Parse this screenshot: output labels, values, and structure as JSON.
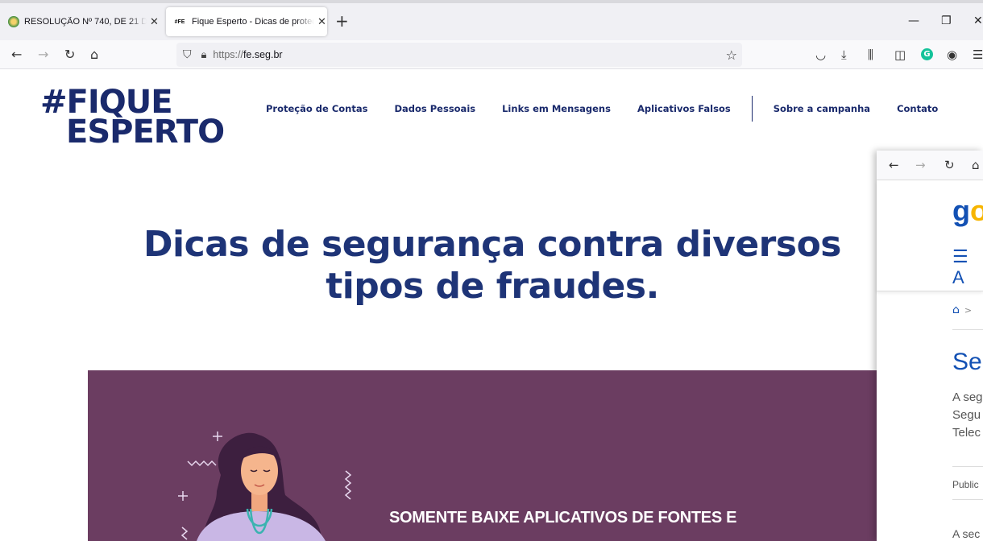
{
  "browser": {
    "tabs": [
      {
        "title": "RESOLUÇÃO Nº 740, DE 21 DE D",
        "active": false
      },
      {
        "title": "Fique Esperto - Dicas de proteç",
        "favicon_text": "#FE",
        "active": true
      }
    ],
    "new_tab": "+",
    "window_controls": {
      "minimize": "—",
      "maximize": "❐",
      "close": "✕"
    },
    "url_protocol": "https://",
    "url_host": "fe.seg.br"
  },
  "site": {
    "logo_line1": "#FIQUE",
    "logo_line2": "ESPERTO",
    "nav": [
      "Proteção de Contas",
      "Dados Pessoais",
      "Links em Mensagens",
      "Aplicativos Falsos",
      "Sobre a campanha",
      "Contato"
    ],
    "headline_line1": "Dicas de segurança contra diversos",
    "headline_line2": "tipos de fraudes.",
    "hero_text": "SOMENTE BAIXE APLICATIVOS DE FONTES E",
    "colors": {
      "brand": "#1a2a6c",
      "headline": "#1e3477",
      "hero_bg": "#6b3d61"
    }
  },
  "overlay_window": {
    "brand_g": "g",
    "brand_o": "o",
    "menu_label": "A",
    "heading": "Se",
    "para_lines": [
      "A seg",
      "Segu",
      "Telec"
    ],
    "published": "Public",
    "para2": "A sec"
  }
}
